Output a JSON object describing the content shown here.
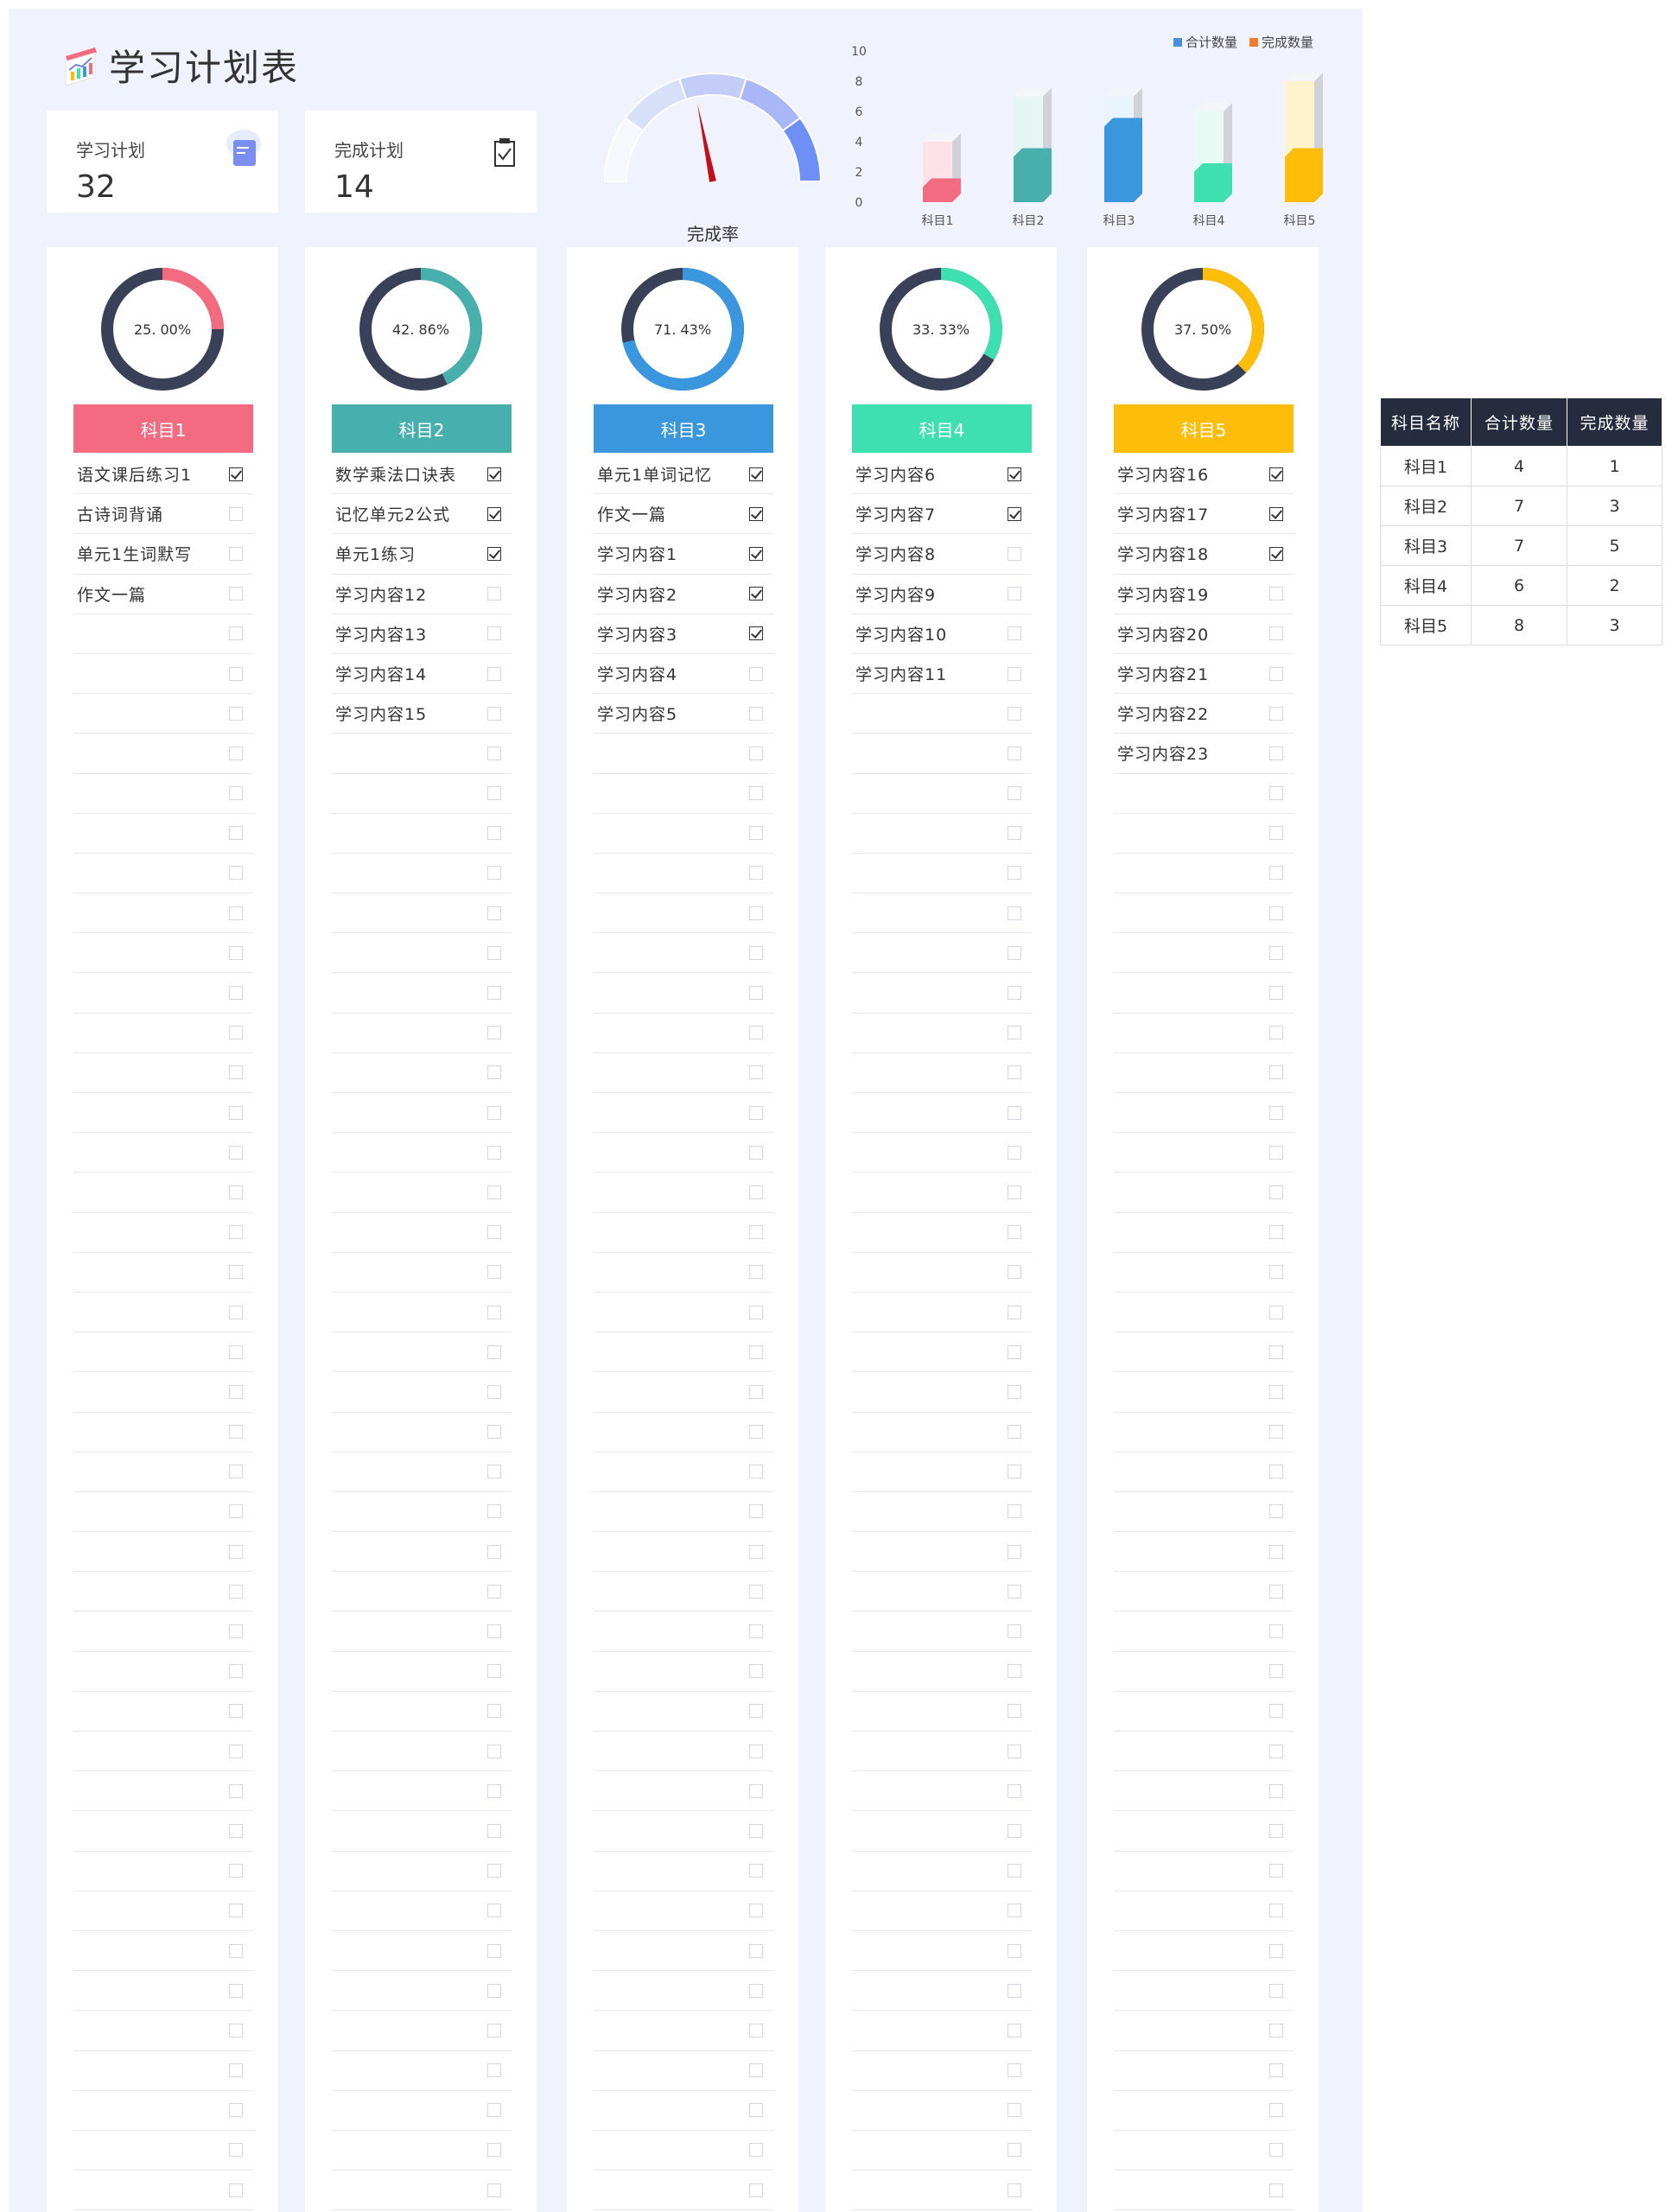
{
  "title": "学习计划表",
  "stats": {
    "plan": {
      "label": "学习计划",
      "value": "32"
    },
    "done": {
      "label": "完成计划",
      "value": "14"
    }
  },
  "gauge": {
    "caption": "完成率",
    "rate": 0.4375
  },
  "chart_data": {
    "type": "bar",
    "categories": [
      "科目1",
      "科目2",
      "科目3",
      "科目4",
      "科目5"
    ],
    "series": [
      {
        "name": "合计数量",
        "values": [
          4,
          7,
          7,
          6,
          8
        ]
      },
      {
        "name": "完成数量",
        "values": [
          1,
          3,
          5,
          2,
          3
        ]
      }
    ],
    "ylim": [
      0,
      10
    ],
    "yticks": [
      "0",
      "2",
      "4",
      "6",
      "8",
      "10"
    ],
    "legend": "top-right"
  },
  "colors": {
    "dark": "#3a4058",
    "subjects": [
      "#f36b80",
      "#47b0ad",
      "#3a96dd",
      "#3ee0b0",
      "#fdbd08"
    ]
  },
  "subjects": [
    {
      "name": "科目1",
      "percent": "25. 00%",
      "rate": 0.25,
      "tasks": [
        {
          "text": "语文课后练习1",
          "done": true
        },
        {
          "text": "古诗词背诵",
          "done": false
        },
        {
          "text": "单元1生词默写",
          "done": false
        },
        {
          "text": "作文一篇",
          "done": false
        }
      ]
    },
    {
      "name": "科目2",
      "percent": "42. 86%",
      "rate": 0.4286,
      "tasks": [
        {
          "text": "数学乘法口诀表",
          "done": true
        },
        {
          "text": "记忆单元2公式",
          "done": true
        },
        {
          "text": "单元1练习",
          "done": true
        },
        {
          "text": "学习内容12",
          "done": false
        },
        {
          "text": "学习内容13",
          "done": false
        },
        {
          "text": "学习内容14",
          "done": false
        },
        {
          "text": "学习内容15",
          "done": false
        }
      ]
    },
    {
      "name": "科目3",
      "percent": "71. 43%",
      "rate": 0.7143,
      "tasks": [
        {
          "text": "单元1单词记忆",
          "done": true
        },
        {
          "text": "作文一篇",
          "done": true
        },
        {
          "text": "学习内容1",
          "done": true
        },
        {
          "text": "学习内容2",
          "done": true
        },
        {
          "text": "学习内容3",
          "done": true
        },
        {
          "text": "学习内容4",
          "done": false
        },
        {
          "text": "学习内容5",
          "done": false
        }
      ]
    },
    {
      "name": "科目4",
      "percent": "33. 33%",
      "rate": 0.3333,
      "tasks": [
        {
          "text": "学习内容6",
          "done": true
        },
        {
          "text": "学习内容7",
          "done": true
        },
        {
          "text": "学习内容8",
          "done": false
        },
        {
          "text": "学习内容9",
          "done": false
        },
        {
          "text": "学习内容10",
          "done": false
        },
        {
          "text": "学习内容11",
          "done": false
        }
      ]
    },
    {
      "name": "科目5",
      "percent": "37. 50%",
      "rate": 0.375,
      "tasks": [
        {
          "text": "学习内容16",
          "done": true
        },
        {
          "text": "学习内容17",
          "done": true
        },
        {
          "text": "学习内容18",
          "done": true
        },
        {
          "text": "学习内容19",
          "done": false
        },
        {
          "text": "学习内容20",
          "done": false
        },
        {
          "text": "学习内容21",
          "done": false
        },
        {
          "text": "学习内容22",
          "done": false
        },
        {
          "text": "学习内容23",
          "done": false
        }
      ]
    }
  ],
  "summary_table": {
    "headers": [
      "科目名称",
      "合计数量",
      "完成数量"
    ],
    "rows": [
      [
        "科目1",
        "4",
        "1"
      ],
      [
        "科目2",
        "7",
        "3"
      ],
      [
        "科目3",
        "7",
        "5"
      ],
      [
        "科目4",
        "6",
        "2"
      ],
      [
        "科目5",
        "8",
        "3"
      ]
    ]
  }
}
